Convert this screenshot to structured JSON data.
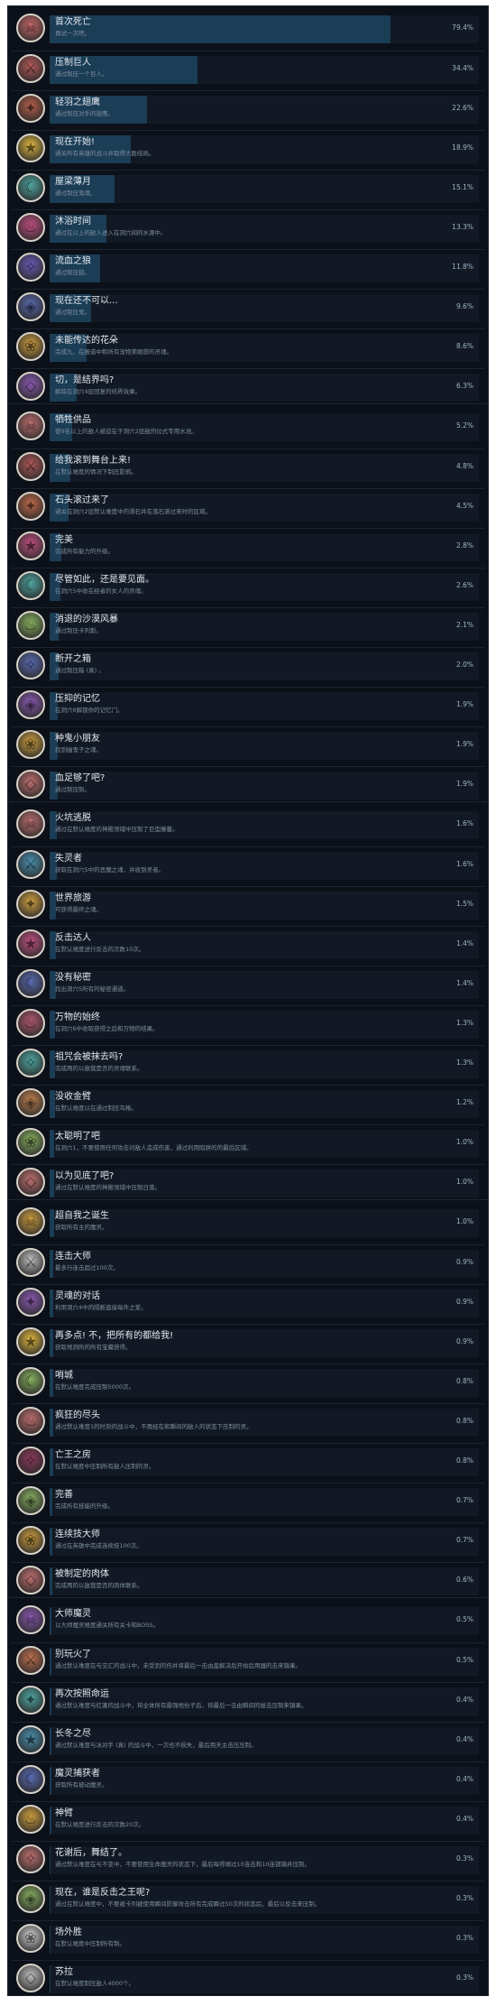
{
  "groups": [
    [
      {
        "name": "首次死亡",
        "desc": "再试一次吧。",
        "percent": 79.4,
        "pct_label": "79.4%",
        "color": "#c96a6a",
        "icon": "skull-icon"
      },
      {
        "name": "压制巨人",
        "desc": "通过制压一个巨人。",
        "percent": 34.4,
        "pct_label": "34.4%",
        "color": "#b55a5a",
        "icon": "giant-icon"
      },
      {
        "name": "轻羽之翅鹰",
        "desc": "通过制压对手的翅鹰。",
        "percent": 22.6,
        "pct_label": "22.6%",
        "color": "#b5604a",
        "icon": "eagle-icon"
      },
      {
        "name": "现在开始!",
        "desc": "通关所有英雄的战斗并取得大胜结局。",
        "percent": 18.9,
        "pct_label": "18.9%",
        "color": "#e0b840",
        "icon": "trophy-icon"
      },
      {
        "name": "屋梁薄月",
        "desc": "通过制压鬼魂。",
        "percent": 15.1,
        "pct_label": "15.1%",
        "color": "#4fa5a0",
        "icon": "moon-icon"
      },
      {
        "name": "沐浴时间",
        "desc": "通过在以上的敌人进入在洞穴间的水源中。",
        "percent": 13.3,
        "pct_label": "13.3%",
        "color": "#c05080",
        "icon": "bath-icon"
      },
      {
        "name": "流血之狼",
        "desc": "通过制压狼。",
        "percent": 11.8,
        "pct_label": "11.8%",
        "color": "#6a5ab5",
        "icon": "wolf-icon"
      },
      {
        "name": "现在还不可以...",
        "desc": "通过制压鬼。",
        "percent": 9.6,
        "pct_label": "9.6%",
        "color": "#5a6ab0",
        "icon": "ghost-icon"
      },
      {
        "name": "未能传达的花朵",
        "desc": "完成九、在报道中和所有宠物美眼旅的灵魂。",
        "percent": 8.6,
        "pct_label": "8.6%",
        "color": "#d0a040",
        "icon": "flower-icon"
      },
      {
        "name": "切，是结界吗?",
        "desc": "解除在洞穴4层回复的结界效果。",
        "percent": 6.3,
        "pct_label": "6.3%",
        "color": "#8a5ab0",
        "icon": "barrier-icon"
      }
    ],
    [
      {
        "name": "牺牲供品",
        "desc": "使9名以上的敌人被迫在于洞穴2层敌的仪式专用水池。",
        "percent": 5.2,
        "pct_label": "5.2%",
        "color": "#c07070",
        "icon": "altar-icon"
      },
      {
        "name": "给我滚到舞台上来!",
        "desc": "在默认难度的情况下制压影鸦。",
        "percent": 4.8,
        "pct_label": "4.8%",
        "color": "#b05858",
        "icon": "stage-icon"
      },
      {
        "name": "石头滚过来了",
        "desc": "通关在洞穴2层默认难度中的滑石并在落石滚过来时的区域。",
        "percent": 4.5,
        "pct_label": "4.5%",
        "color": "#c06a4a",
        "icon": "boulder-icon"
      },
      {
        "name": "完美",
        "desc": "完成所有能力的升级。",
        "percent": 2.8,
        "pct_label": "2.8%",
        "color": "#c05080",
        "icon": "star-icon"
      },
      {
        "name": "尽管如此，还是要见面。",
        "desc": "在洞穴5中收在经者的女人的灵魂。",
        "percent": 2.6,
        "pct_label": "2.6%",
        "color": "#4fa5a0",
        "icon": "woman-icon"
      },
      {
        "name": "消退的沙漠风暴",
        "desc": "通过制压卡列斯。",
        "percent": 2.1,
        "pct_label": "2.1%",
        "color": "#88b060",
        "icon": "sandstorm-icon"
      },
      {
        "name": "断开之箱",
        "desc": "通过制压箱 (真) 。",
        "percent": 2.0,
        "pct_label": "2.0%",
        "color": "#5a6ab0",
        "icon": "box-icon"
      },
      {
        "name": "压抑的记忆",
        "desc": "在洞穴6解锁你的记忆门。",
        "percent": 1.9,
        "pct_label": "1.9%",
        "color": "#8a5ab0",
        "icon": "memory-icon"
      },
      {
        "name": "种鬼小朋友",
        "desc": "找到幽鬼子之魂。",
        "percent": 1.9,
        "pct_label": "1.9%",
        "color": "#d0a040",
        "icon": "child-ghost-icon"
      },
      {
        "name": "血足够了吧?",
        "desc": "通过制压制。",
        "percent": 1.9,
        "pct_label": "1.9%",
        "color": "#c07070",
        "icon": "blood-icon"
      }
    ],
    [
      {
        "name": "火坑逃脱",
        "desc": "通过在默认难度的神殿领域中压制了巨型藤蔓。",
        "percent": 1.6,
        "pct_label": "1.6%",
        "color": "#c07070",
        "icon": "fire-icon"
      },
      {
        "name": "失灵者",
        "desc": "获取在洞穴5中的恶魔之魂，并收到灵者。",
        "percent": 1.6,
        "pct_label": "1.6%",
        "color": "#4a90b0",
        "icon": "spirit-icon"
      },
      {
        "name": "世界旅游",
        "desc": "可获得最终之魂。",
        "percent": 1.5,
        "pct_label": "1.5%",
        "color": "#d0a040",
        "icon": "world-icon"
      },
      {
        "name": "反击达人",
        "desc": "在默认难度进行反击的次数10次。",
        "percent": 1.4,
        "pct_label": "1.4%",
        "color": "#c05080",
        "icon": "counter-icon"
      },
      {
        "name": "没有秘密",
        "desc": "找出洞穴5所有的秘密通道。",
        "percent": 1.4,
        "pct_label": "1.4%",
        "color": "#5a6ab0",
        "icon": "secret-icon"
      },
      {
        "name": "万物的始终",
        "desc": "在洞穴6中收取获得之后和万物的结果。",
        "percent": 1.3,
        "pct_label": "1.3%",
        "color": "#b05870",
        "icon": "grapes-icon"
      },
      {
        "name": "祖咒会被抹去吗?",
        "desc": "完成两的以敌我是否的灵魂联系。",
        "percent": 1.3,
        "pct_label": "1.3%",
        "color": "#4fa5a0",
        "icon": "curse-icon"
      },
      {
        "name": "没收金臂",
        "desc": "在默认难度以在通过制压鸟格。",
        "percent": 1.2,
        "pct_label": "1.2%",
        "color": "#c08050",
        "icon": "arm-icon"
      },
      {
        "name": "太聪明了吧",
        "desc": "在洞穴1，不要使用任何攻击对敌人造成伤害，通过利用陷阱的的最后区域。",
        "percent": 1.0,
        "pct_label": "1.0%",
        "color": "#88b060",
        "icon": "brain-icon"
      },
      {
        "name": "以为见底了吧?",
        "desc": "通过在默认难度的神殿领域中压制日落。",
        "percent": 1.0,
        "pct_label": "1.0%",
        "color": "#c07070",
        "icon": "abyss-icon"
      }
    ],
    [
      {
        "name": "超自我之诞生",
        "desc": "获取所有主的魔灵。",
        "percent": 1.0,
        "pct_label": "1.0%",
        "color": "#d0a040",
        "icon": "rebirth-icon"
      },
      {
        "name": "连击大师",
        "desc": "最多行连击超过100次。",
        "percent": 0.9,
        "pct_label": "0.9%",
        "color": "#c0c0c0",
        "icon": "combo-icon"
      },
      {
        "name": "灵魂的对话",
        "desc": "利用洞穴4中的隔断直接每件之爱。",
        "percent": 0.9,
        "pct_label": "0.9%",
        "color": "#8a5ab0",
        "icon": "soul-icon"
      },
      {
        "name": "再多点! 不，把所有的都给我!",
        "desc": "获取地洞所的所有宝藏获得。",
        "percent": 0.9,
        "pct_label": "0.9%",
        "color": "#e0b840",
        "icon": "treasure-icon"
      },
      {
        "name": "哨城",
        "desc": "在默认难度完成压制5000次。",
        "percent": 0.8,
        "pct_label": "0.8%",
        "color": "#88b060",
        "icon": "sentry-icon"
      },
      {
        "name": "疯狂的尽头",
        "desc": "通过默认难度1的时刻的战斗中，不再经在和瞬间的敌人的状态下压制的灵。",
        "percent": 0.8,
        "pct_label": "0.8%",
        "color": "#c07070",
        "icon": "madness-icon"
      },
      {
        "name": "亡王之房",
        "desc": "在默认难度中压制所有敌人压制的灵。",
        "percent": 0.8,
        "pct_label": "0.8%",
        "color": "#8a3a5a",
        "icon": "door-icon"
      },
      {
        "name": "完善",
        "desc": "完成所有技能的升级。",
        "percent": 0.7,
        "pct_label": "0.7%",
        "color": "#88b060",
        "icon": "complete-icon"
      },
      {
        "name": "连续技大师",
        "desc": "通过在英雄中完成连续技100次。",
        "percent": 0.7,
        "pct_label": "0.7%",
        "color": "#d0a040",
        "icon": "combo-master-icon"
      },
      {
        "name": "被制定的肉体",
        "desc": "完成两的以敌我是否的肉体联系。",
        "percent": 0.6,
        "pct_label": "0.6%",
        "color": "#c07070",
        "icon": "flesh-icon"
      }
    ],
    [
      {
        "name": "大师魔灵",
        "desc": "以大师魔灵难度通关所有关卡和BOSS。",
        "percent": 0.5,
        "pct_label": "0.5%",
        "color": "#8a5ab0",
        "icon": "master-icon"
      },
      {
        "name": "别玩火了",
        "desc": "通过默认难度在与交汇的战斗中，未受到的伤并将最后一击由盖解决后开始后用器的击来镇果。",
        "percent": 0.5,
        "pct_label": "0.5%",
        "color": "#c07050",
        "icon": "flame-icon"
      },
      {
        "name": "再次按照命运",
        "desc": "通过默认难度与红蓬的战斗中，将全体所有最强地份子后，将最后一击由瞬间的拔击压制来镇果。",
        "percent": 0.4,
        "pct_label": "0.4%",
        "color": "#4fa5a0",
        "icon": "fate-icon"
      },
      {
        "name": "长冬之尽",
        "desc": "通过默认难度与冰对手 (真) 的战斗中，一次也不损失，最后用天主击压压制。",
        "percent": 0.4,
        "pct_label": "0.4%",
        "color": "#4a90b0",
        "icon": "winter-icon"
      },
      {
        "name": "魔灵捕获者",
        "desc": "获取所有被动魔灵。",
        "percent": 0.4,
        "pct_label": "0.4%",
        "color": "#5a6ab0",
        "icon": "catcher-icon"
      },
      {
        "name": "神臂",
        "desc": "在默认难度进行反击的次数20次。",
        "percent": 0.4,
        "pct_label": "0.4%",
        "color": "#d0a040",
        "icon": "arm-god-icon"
      },
      {
        "name": "花谢后，舞结了。",
        "desc": "通过默认难度在与不变中，不要使用生命魔灵的状态下，最后每得顺过10连击和10连锁镇并压制。",
        "percent": 0.3,
        "pct_label": "0.3%",
        "color": "#c07070",
        "icon": "blossom-icon"
      },
      {
        "name": "现在，谁是反击之王呢?",
        "desc": "通过在默认难度中，不要被卡列被使用瞬间防御攻击所有完成瞬过50次的状态后，最后以反击来压制。",
        "percent": 0.3,
        "pct_label": "0.3%",
        "color": "#88b060",
        "icon": "king-icon"
      },
      {
        "name": "场外胜",
        "desc": "在默认难度中压制所有制。",
        "percent": 0.3,
        "pct_label": "0.3%",
        "color": "#d0d0d0",
        "icon": "ring-icon"
      },
      {
        "name": "苏拉",
        "desc": "在默认难度制压敌人4000个。",
        "percent": 0.3,
        "pct_label": "0.3%",
        "color": "#c0c0c0",
        "icon": "sura-icon"
      }
    ]
  ]
}
